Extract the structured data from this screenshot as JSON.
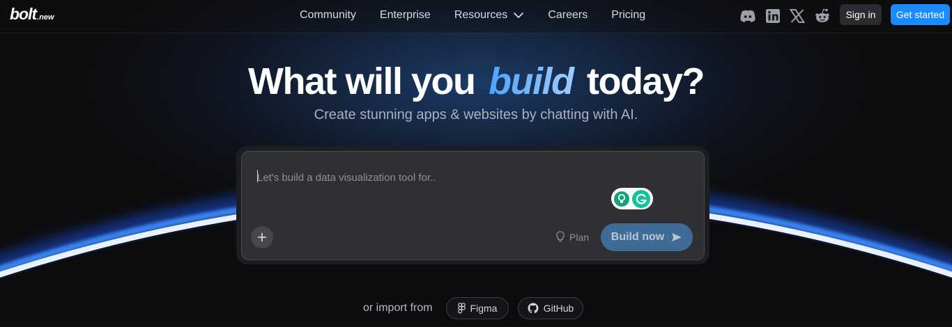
{
  "brand": {
    "logo_main": "bolt",
    "logo_suffix": ".new"
  },
  "nav": {
    "links": [
      "Community",
      "Enterprise",
      "Resources",
      "Careers",
      "Pricing"
    ],
    "social_icons": [
      "discord-icon",
      "linkedin-icon",
      "x-icon",
      "reddit-icon"
    ],
    "sign_in": "Sign in",
    "get_started": "Get started"
  },
  "hero": {
    "title_before": "What will you",
    "title_accent": "build",
    "title_after": "today?",
    "subtitle": "Create stunning apps & websites by chatting with AI."
  },
  "prompt": {
    "placeholder": "Let's build a data visualization tool for..",
    "value": "",
    "plan_label": "Plan",
    "build_label": "Build now"
  },
  "import": {
    "label": "or import from",
    "options": [
      "Figma",
      "GitHub"
    ]
  },
  "colors": {
    "accent": "#1a8cff",
    "build_button": "#3f6c97",
    "glow": "#2f7cff"
  }
}
